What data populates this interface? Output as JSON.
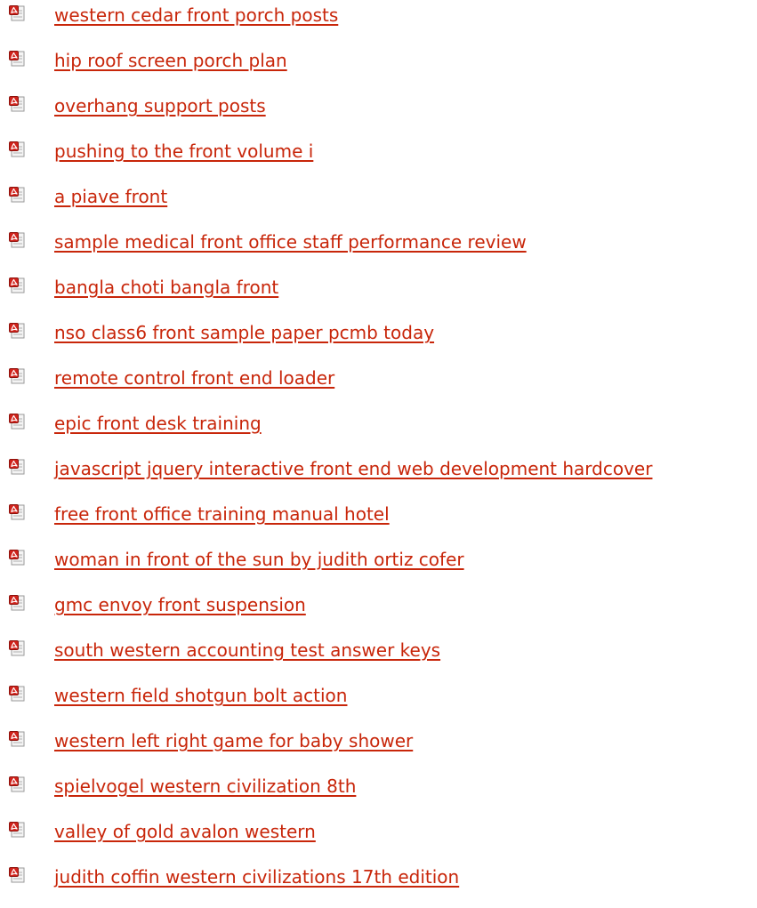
{
  "colors": {
    "link": "#c8260a",
    "icon_red": "#d0231c",
    "background": "#ffffff"
  },
  "icon_name": "pdf-file-icon",
  "items": [
    {
      "label": "western cedar front porch posts"
    },
    {
      "label": "hip roof screen porch plan"
    },
    {
      "label": "overhang support posts"
    },
    {
      "label": "pushing to the front volume i"
    },
    {
      "label": "a piave front"
    },
    {
      "label": "sample medical front office staff performance review"
    },
    {
      "label": "bangla choti bangla front"
    },
    {
      "label": "nso class6 front sample paper pcmb today"
    },
    {
      "label": "remote control front end loader"
    },
    {
      "label": "epic front desk training"
    },
    {
      "label": "javascript jquery interactive front end web development hardcover"
    },
    {
      "label": "free front office training manual hotel"
    },
    {
      "label": "woman in front of the sun by judith ortiz cofer"
    },
    {
      "label": "gmc envoy front suspension"
    },
    {
      "label": "south western accounting test answer keys"
    },
    {
      "label": "western field shotgun bolt action"
    },
    {
      "label": "western left right game for baby shower"
    },
    {
      "label": "spielvogel western civilization 8th"
    },
    {
      "label": "valley of gold avalon western"
    },
    {
      "label": "judith coffin western civilizations 17th edition"
    }
  ]
}
